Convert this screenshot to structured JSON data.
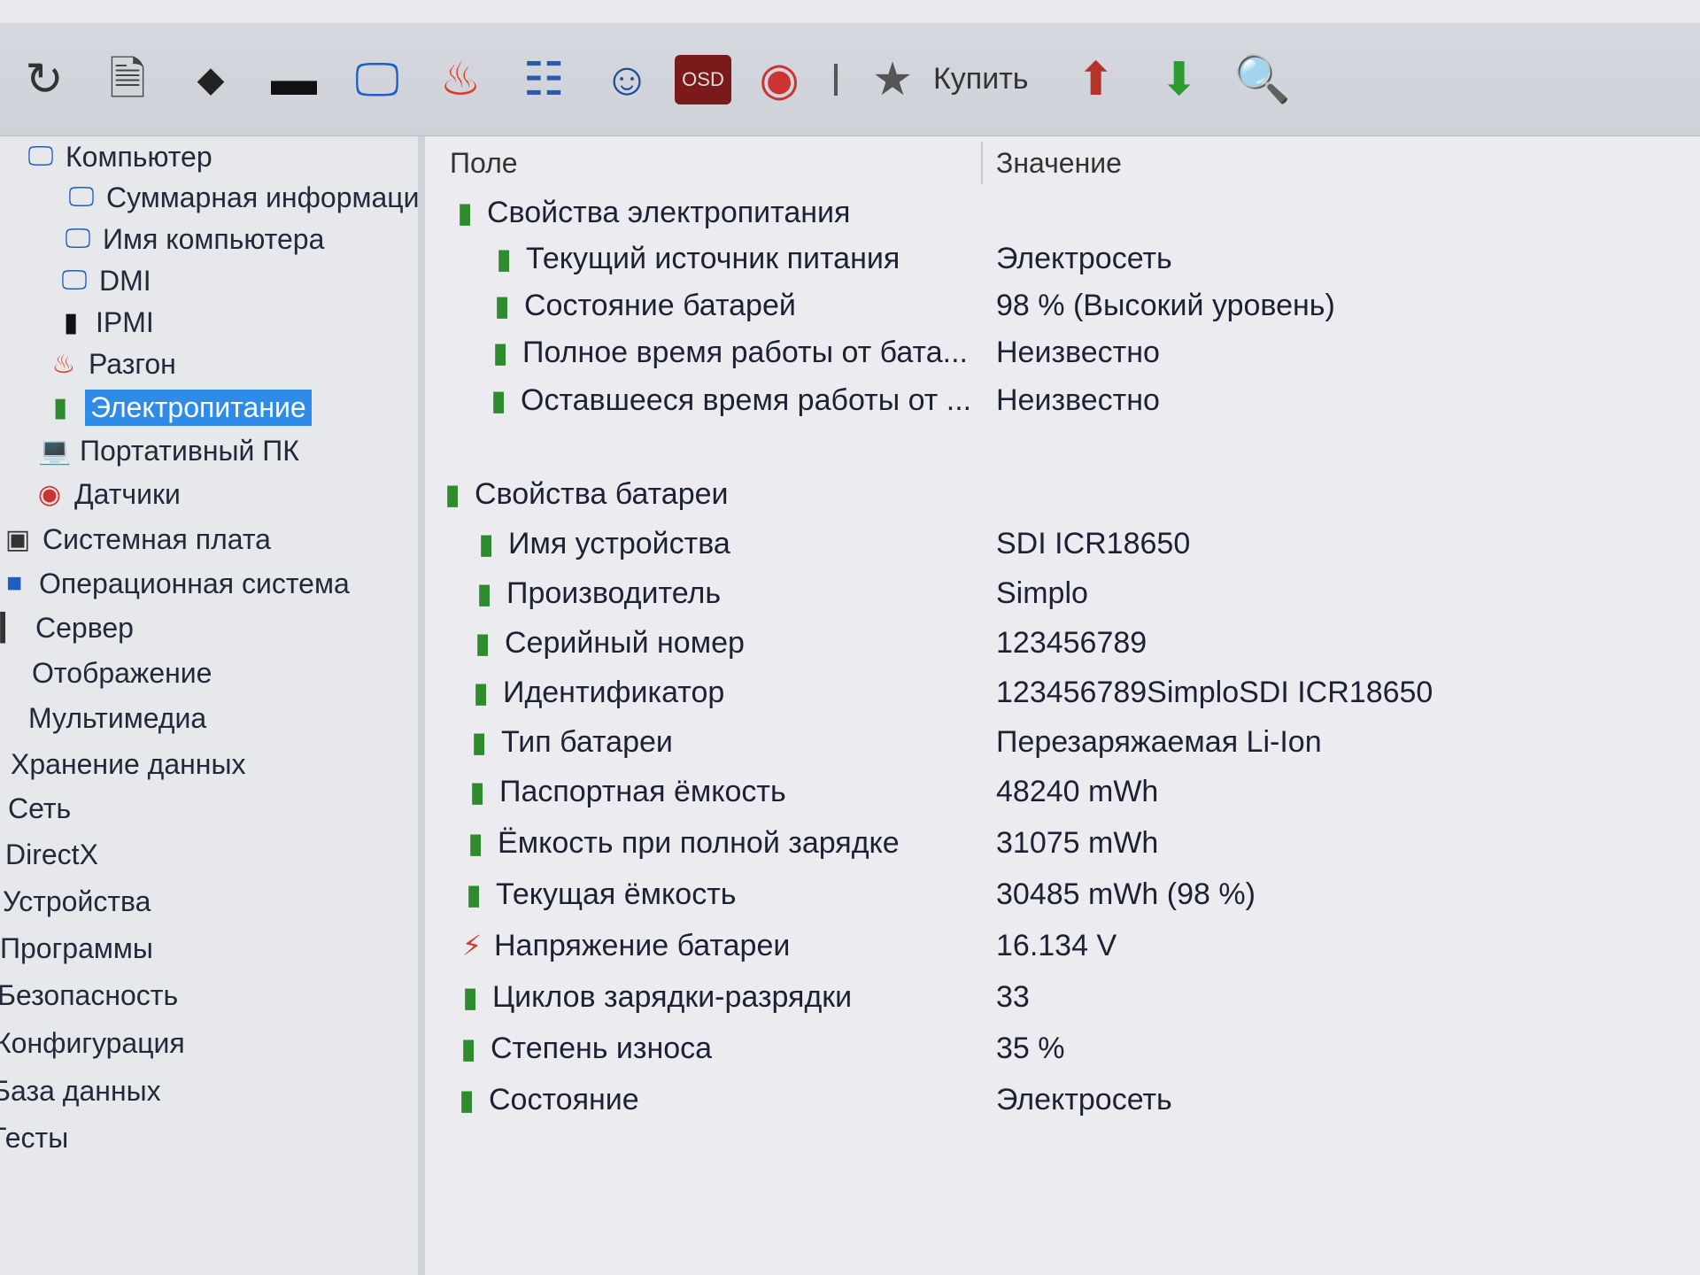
{
  "toolbar": {
    "icons": [
      "refresh-icon",
      "report-icon",
      "motherboard-icon",
      "memory-icon",
      "monitor-icon",
      "overclock-flame-icon",
      "device-list-icon",
      "user-icon",
      "osd-icon",
      "sensor-gauge-icon"
    ],
    "osd_label": "OSD",
    "buy_label": "Купить",
    "extra_icons": [
      "up-arrow-icon",
      "down-arrow-icon",
      "search-icon"
    ]
  },
  "sidebar": {
    "items": [
      {
        "label": "Компьютер",
        "icon": "computer-icon",
        "selected": false
      },
      {
        "label": "Суммарная информаци",
        "icon": "computer-icon",
        "selected": false
      },
      {
        "label": "Имя компьютера",
        "icon": "computer-icon",
        "selected": false
      },
      {
        "label": "DMI",
        "icon": "computer-icon",
        "selected": false
      },
      {
        "label": "IPMI",
        "icon": "server-icon",
        "selected": false
      },
      {
        "label": "Разгон",
        "icon": "flame-icon",
        "selected": false
      },
      {
        "label": "Электропитание",
        "icon": "battery-icon",
        "selected": true
      },
      {
        "label": "Портативный ПК",
        "icon": "laptop-icon",
        "selected": false
      },
      {
        "label": "Датчики",
        "icon": "gauge-icon",
        "selected": false
      },
      {
        "label": "Системная плата",
        "icon": "board-icon",
        "selected": false
      },
      {
        "label": "Операционная система",
        "icon": "windows-icon",
        "selected": false
      },
      {
        "label": "Сервер",
        "icon": "server-icon",
        "selected": false
      },
      {
        "label": "Отображение",
        "icon": "display-icon",
        "selected": false
      },
      {
        "label": "Мультимедиа",
        "icon": "media-icon",
        "selected": false
      },
      {
        "label": "Хранение данных",
        "icon": "",
        "selected": false
      },
      {
        "label": "Сеть",
        "icon": "",
        "selected": false
      },
      {
        "label": "DirectX",
        "icon": "",
        "selected": false
      },
      {
        "label": "Устройства",
        "icon": "",
        "selected": false
      },
      {
        "label": "Программы",
        "icon": "",
        "selected": false
      },
      {
        "label": "Безопасность",
        "icon": "",
        "selected": false
      },
      {
        "label": "Конфигурация",
        "icon": "",
        "selected": false
      },
      {
        "label": "База данных",
        "icon": "",
        "selected": false
      },
      {
        "label": "Тесты",
        "icon": "",
        "selected": false
      }
    ]
  },
  "table": {
    "columns": {
      "field": "Поле",
      "value": "Значение"
    },
    "groups": [
      {
        "title": "Свойства электропитания",
        "rows": [
          {
            "field": "Текущий источник питания",
            "value": "Электросеть"
          },
          {
            "field": "Состояние батарей",
            "value": "98 % (Высокий уровень)"
          },
          {
            "field": "Полное время работы от бата...",
            "value": "Неизвестно"
          },
          {
            "field": "Оставшееся время работы от ...",
            "value": "Неизвестно"
          }
        ]
      },
      {
        "title": "Свойства батареи",
        "rows": [
          {
            "field": "Имя устройства",
            "value": "SDI ICR18650"
          },
          {
            "field": "Производитель",
            "value": "Simplo"
          },
          {
            "field": "Серийный номер",
            "value": "123456789"
          },
          {
            "field": "Идентификатор",
            "value": "123456789SimploSDI ICR18650"
          },
          {
            "field": "Тип батареи",
            "value": "Перезаряжаемая Li-Ion"
          },
          {
            "field": "Паспортная ёмкость",
            "value": "48240 mWh"
          },
          {
            "field": "Ёмкость при полной зарядке",
            "value": "31075 mWh"
          },
          {
            "field": "Текущая ёмкость",
            "value": "30485 mWh  (98 %)"
          },
          {
            "field": "Напряжение батареи",
            "value": "16.134 V",
            "icon": "voltage-icon"
          },
          {
            "field": "Циклов зарядки-разрядки",
            "value": "33"
          },
          {
            "field": "Степень износа",
            "value": "35 %"
          },
          {
            "field": "Состояние",
            "value": "Электросеть"
          }
        ]
      }
    ]
  }
}
